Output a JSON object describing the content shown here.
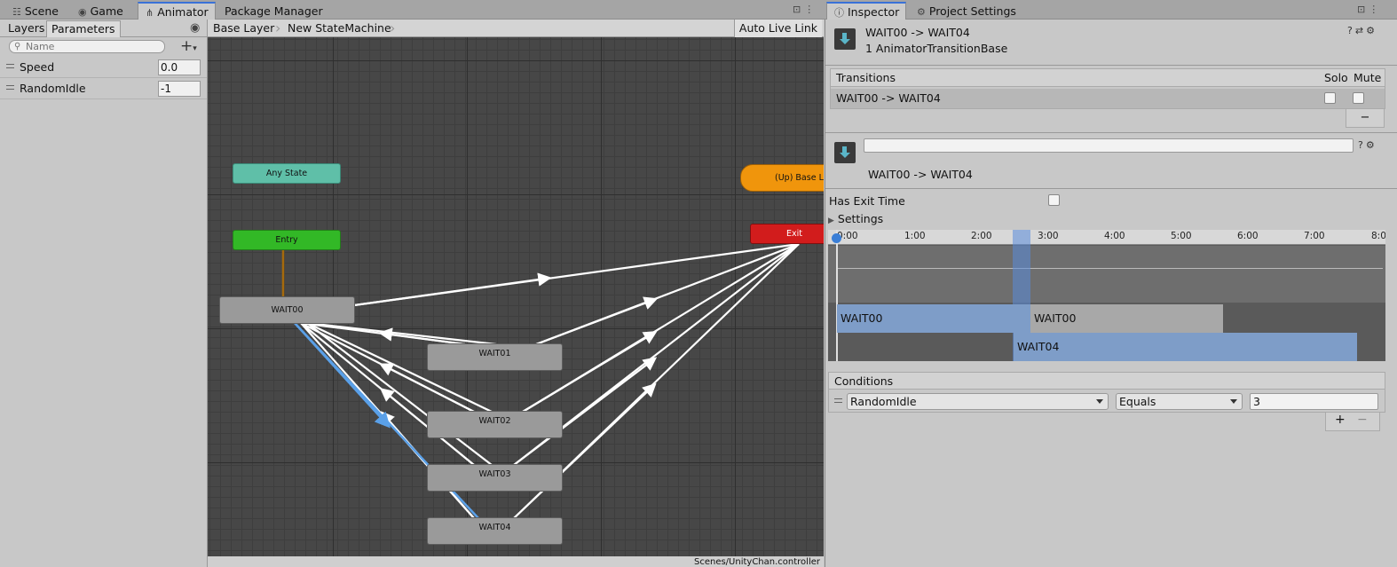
{
  "tabs_left": [
    {
      "label": "Scene",
      "icon": "grid-icon"
    },
    {
      "label": "Game",
      "icon": "gamepad-icon"
    },
    {
      "label": "Animator",
      "icon": "animator-icon"
    },
    {
      "label": "Package Manager",
      "icon": ""
    }
  ],
  "tabs_right": [
    {
      "label": "Inspector",
      "icon": "info-icon"
    },
    {
      "label": "Project Settings",
      "icon": "gear-icon"
    }
  ],
  "left_panel": {
    "subtabs": [
      "Layers",
      "Parameters"
    ],
    "search_placeholder": "Name",
    "parameters": [
      {
        "name": "Speed",
        "value": "0.0"
      },
      {
        "name": "RandomIdle",
        "value": "-1"
      }
    ]
  },
  "breadcrumb": {
    "items": [
      "Base Layer",
      "New StateMachine"
    ],
    "auto_live_link": "Auto Live Link"
  },
  "graph": {
    "nodes": {
      "any_state": "Any State",
      "entry": "Entry",
      "up_base_layer": "(Up) Base Layer",
      "exit": "Exit",
      "wait00": "WAIT00",
      "wait01": "WAIT01",
      "wait02": "WAIT02",
      "wait03": "WAIT03",
      "wait04": "WAIT04"
    },
    "colors": {
      "any_state": "#5fbfa8",
      "entry": "#32b826",
      "exit": "#d21c1c",
      "up": "#f0950c",
      "state": "#9a9a9a",
      "selected_transition": "#5aa0e8"
    },
    "status_path": "Scenes/UnityChan.controller"
  },
  "inspector": {
    "title": "WAIT00 -> WAIT04",
    "subtitle": "1 AnimatorTransitionBase",
    "transitions_header": "Transitions",
    "solo_label": "Solo",
    "mute_label": "Mute",
    "transition_row": "WAIT00 -> WAIT04",
    "remove_label": "−",
    "transition_name_value": "",
    "transition_title": "WAIT00 -> WAIT04",
    "has_exit_time_label": "Has Exit Time",
    "settings_label": "Settings",
    "timeline": {
      "ticks": [
        "0:00",
        "1:00",
        "2:00",
        "3:00",
        "4:00",
        "5:00",
        "6:00",
        "7:00",
        "8:0"
      ],
      "source_clip": "WAIT00",
      "source_clip_repeat": "WAIT00",
      "dest_clip": "WAIT04"
    },
    "conditions_header": "Conditions",
    "condition": {
      "parameter": "RandomIdle",
      "mode": "Equals",
      "value": "3"
    },
    "add_label": "+",
    "minus_label": "−"
  }
}
